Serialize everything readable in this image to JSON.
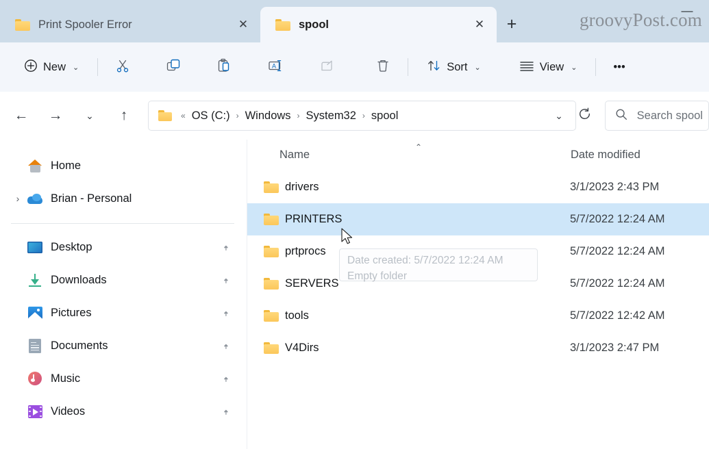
{
  "window": {
    "watermark": "groovyPost.com",
    "minimize_label": "—",
    "new_tab_label": "+",
    "tabs": [
      {
        "label": "Print Spooler Error",
        "icon": "folder-icon",
        "close_label": "✕",
        "active": false
      },
      {
        "label": "spool",
        "icon": "folder-icon",
        "close_label": "✕",
        "active": true
      }
    ]
  },
  "toolbar": {
    "new_label": "New",
    "new_icon": "plus-circle-icon",
    "new_chevron": "⌄",
    "cut_icon": "scissors-icon",
    "copy_icon": "copy-icon",
    "paste_icon": "paste-icon",
    "rename_icon": "rename-icon",
    "share_icon": "share-icon",
    "delete_icon": "trash-icon",
    "sort_label": "Sort",
    "sort_icon": "sort-arrows-icon",
    "sort_chevron": "⌄",
    "view_label": "View",
    "view_icon": "view-lines-icon",
    "view_chevron": "⌄",
    "more_label": "•••"
  },
  "navigation": {
    "back_icon": "←",
    "forward_icon": "→",
    "recent_icon": "⌄",
    "up_icon": "↑",
    "breadcrumb_folder_icon": "folder-icon",
    "breadcrumb_overflow": "«",
    "breadcrumb": [
      "OS (C:)",
      "Windows",
      "System32",
      "spool"
    ],
    "breadcrumb_separator": "›",
    "address_dropdown_icon": "⌄",
    "refresh_icon": "refresh-icon"
  },
  "search": {
    "placeholder": "Search spool",
    "icon": "search-icon"
  },
  "sidebar": {
    "groups": [
      {
        "items": [
          {
            "label": "Home",
            "icon": "home-icon",
            "expander": "",
            "pinned": false
          },
          {
            "label": "Brian - Personal",
            "icon": "onedrive-cloud-icon",
            "expander": "›",
            "pinned": false
          }
        ]
      },
      {
        "items": [
          {
            "label": "Desktop",
            "icon": "desktop-icon",
            "expander": "",
            "pinned": true
          },
          {
            "label": "Downloads",
            "icon": "downloads-icon",
            "expander": "",
            "pinned": true
          },
          {
            "label": "Pictures",
            "icon": "pictures-icon",
            "expander": "",
            "pinned": true
          },
          {
            "label": "Documents",
            "icon": "documents-icon",
            "expander": "",
            "pinned": true
          },
          {
            "label": "Music",
            "icon": "music-icon",
            "expander": "",
            "pinned": true
          },
          {
            "label": "Videos",
            "icon": "videos-icon",
            "expander": "",
            "pinned": true
          }
        ]
      }
    ],
    "pin_glyph": "📌"
  },
  "filelist": {
    "columns": {
      "name": "Name",
      "date_modified": "Date modified"
    },
    "sort_indicator": "⌃",
    "rows": [
      {
        "name": "drivers",
        "date_modified": "3/1/2023 2:43 PM",
        "selected": false
      },
      {
        "name": "PRINTERS",
        "date_modified": "5/7/2022 12:24 AM",
        "selected": true
      },
      {
        "name": "prtprocs",
        "date_modified": "5/7/2022 12:24 AM",
        "selected": false
      },
      {
        "name": "SERVERS",
        "date_modified": "5/7/2022 12:24 AM",
        "selected": false
      },
      {
        "name": "tools",
        "date_modified": "5/7/2022 12:42 AM",
        "selected": false
      },
      {
        "name": "V4Dirs",
        "date_modified": "3/1/2023 2:47 PM",
        "selected": false
      }
    ]
  },
  "tooltip": {
    "line1": "Date created: 5/7/2022 12:24 AM",
    "line2": "Empty folder"
  },
  "colors": {
    "titlebar": "#cddce9",
    "command_bar": "#f3f6fb",
    "accent_blue": "#0f6cbd",
    "selection": "#cee6f9",
    "folder_yellow": "#fbc75a"
  }
}
